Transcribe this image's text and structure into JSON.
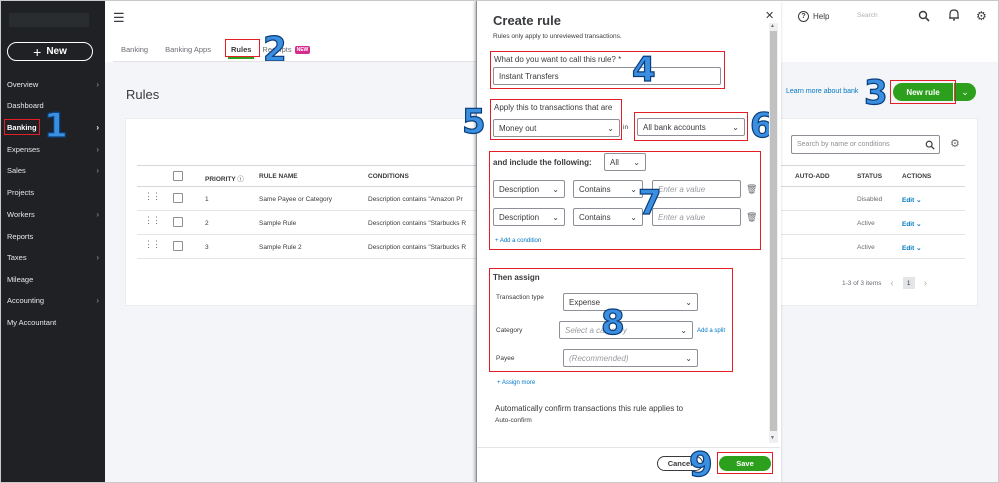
{
  "sidebar": {
    "new_label": "New",
    "items": [
      {
        "label": "Overview",
        "chevron": true
      },
      {
        "label": "Dashboard",
        "chevron": false
      },
      {
        "label": "Banking",
        "chevron": true
      },
      {
        "label": "Expenses",
        "chevron": true
      },
      {
        "label": "Sales",
        "chevron": true
      },
      {
        "label": "Projects",
        "chevron": false
      },
      {
        "label": "Workers",
        "chevron": true
      },
      {
        "label": "Reports",
        "chevron": false
      },
      {
        "label": "Taxes",
        "chevron": true
      },
      {
        "label": "Mileage",
        "chevron": false
      },
      {
        "label": "Accounting",
        "chevron": true
      },
      {
        "label": "My Accountant",
        "chevron": false
      }
    ]
  },
  "topbar": {
    "help_label": "Help",
    "search_placeholder": "Search"
  },
  "tabs": [
    {
      "label": "Banking"
    },
    {
      "label": "Banking Apps"
    },
    {
      "label": "Rules"
    },
    {
      "label": "Receipts",
      "badge": "NEW"
    }
  ],
  "page": {
    "title": "Rules",
    "learn_more": "Learn more about bank",
    "new_rule_label": "New rule"
  },
  "table": {
    "search_placeholder": "Search by name or conditions",
    "headers": {
      "priority": "PRIORITY",
      "rule_name": "RULE NAME",
      "conditions": "CONDITIONS",
      "auto_add": "AUTO-ADD",
      "status": "STATUS",
      "actions": "ACTIONS"
    },
    "rows": [
      {
        "priority": "1",
        "rule_name": "Same Payee or Category",
        "conditions": "Description contains \"Amazon Pr",
        "status": "Disabled",
        "action": "Edit"
      },
      {
        "priority": "2",
        "rule_name": "Sample Rule",
        "conditions": "Description contains \"Starbucks R",
        "status": "Active",
        "action": "Edit"
      },
      {
        "priority": "3",
        "rule_name": "Sample Rule 2",
        "conditions": "Description contains \"Starbucks R",
        "status": "Active",
        "action": "Edit"
      }
    ],
    "pager_text": "1-3 of 3 items",
    "current_page": "1"
  },
  "modal": {
    "title": "Create rule",
    "subtitle": "Rules only apply to unreviewed transactions.",
    "name_question": "What do you want to call this rule? *",
    "name_value": "Instant Transfers",
    "apply_label": "Apply this to transactions that are",
    "apply_value": "Money out",
    "in_label": "in",
    "accounts_value": "All bank accounts",
    "include_label": "and include the following:",
    "include_mode": "All",
    "conditions": [
      {
        "field": "Description",
        "op": "Contains",
        "placeholder": "Enter a value"
      },
      {
        "field": "Description",
        "op": "Contains",
        "placeholder": "Enter a value"
      }
    ],
    "add_condition": "+ Add a condition",
    "then_assign": "Then assign",
    "transaction_type_label": "Transaction type",
    "transaction_type_value": "Expense",
    "category_label": "Category",
    "category_placeholder": "Select a category",
    "add_split": "Add a split",
    "payee_label": "Payee",
    "payee_placeholder": "(Recommended)",
    "assign_more": "+ Assign more",
    "auto_confirm_title": "Automatically confirm transactions this rule applies to",
    "auto_confirm_label": "Auto-confirm",
    "cancel_label": "Cancel",
    "save_label": "Save"
  },
  "annotations": [
    "1",
    "2",
    "3",
    "4",
    "5",
    "6",
    "7",
    "8",
    "9"
  ],
  "colors": {
    "brand_green": "#2ca01c",
    "link_blue": "#0077c5",
    "highlight_red": "#e21f26",
    "sidebar_bg": "#1f2124",
    "step_number_blue": "#3a8fe0"
  }
}
